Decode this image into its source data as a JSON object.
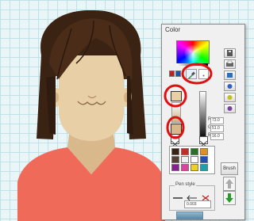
{
  "panel": {
    "title": "Color",
    "rgb": {
      "r_label": "R",
      "r_value": "73.0",
      "g_label": "G",
      "g_value": "51.0",
      "b_label": "B",
      "b_value": "16.0"
    },
    "brush_label": "Brush",
    "pen_style_label": "Pen style",
    "pen_width_value": "0.003"
  },
  "palette": [
    "#3b2314",
    "#c03020",
    "#2a6f2a",
    "#e09020",
    "#5a4030",
    "#f0f0f0",
    "#ffffff",
    "#2050b0",
    "#8a2090",
    "#e040a0",
    "#f0d020",
    "#1aa0b0"
  ],
  "colors": {
    "hair": "#3b2314",
    "skin": "#e8cfa5",
    "shirt": "#f06a5a",
    "annotation": "#e01010"
  }
}
